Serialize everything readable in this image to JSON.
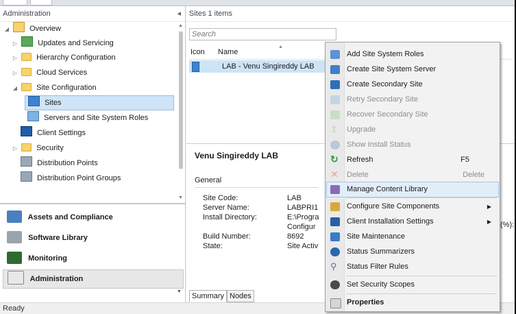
{
  "nav": {
    "header": "Administration",
    "tree": [
      {
        "label": "Overview"
      },
      {
        "label": "Updates and Servicing"
      },
      {
        "label": "Hierarchy Configuration"
      },
      {
        "label": "Cloud Services"
      },
      {
        "label": "Site Configuration"
      },
      {
        "label": "Sites"
      },
      {
        "label": "Servers and Site System Roles"
      },
      {
        "label": "Client Settings"
      },
      {
        "label": "Security"
      },
      {
        "label": "Distribution Points"
      },
      {
        "label": "Distribution Point Groups"
      }
    ],
    "workspaces": [
      {
        "label": "Assets and Compliance"
      },
      {
        "label": "Software Library"
      },
      {
        "label": "Monitoring"
      },
      {
        "label": "Administration"
      }
    ]
  },
  "main": {
    "breadcrumb": "Sites 1 items",
    "search_placeholder": "Search",
    "columns": [
      "Icon",
      "Name"
    ],
    "rows": [
      {
        "name": "LAB - Venu Singireddy LAB"
      }
    ],
    "detail": {
      "title": "Venu Singireddy LAB",
      "section": "General",
      "fields": [
        {
          "key": "Site Code:",
          "value": "LAB"
        },
        {
          "key": "Server Name:",
          "value": "LABPRI1"
        },
        {
          "key": "Install Directory:",
          "value": "E:\\Progra"
        },
        {
          "key": "",
          "value": "Configur"
        },
        {
          "key": "Build Number:",
          "value": "8692"
        },
        {
          "key": "State:",
          "value": "Site Activ"
        }
      ],
      "overflow_text": "(%):"
    },
    "tabs": [
      "Summary",
      "Nodes"
    ]
  },
  "context_menu": {
    "items": [
      {
        "label": "Add Site System Roles",
        "shortcut": "",
        "disabled": false,
        "icon": "add-roles-icon"
      },
      {
        "label": "Create Site System Server",
        "shortcut": "",
        "disabled": false,
        "icon": "server-icon"
      },
      {
        "label": "Create Secondary Site",
        "shortcut": "",
        "disabled": false,
        "icon": "secondary-site-icon"
      },
      {
        "label": "Retry Secondary Site",
        "shortcut": "",
        "disabled": true,
        "icon": "retry-icon"
      },
      {
        "label": "Recover Secondary Site",
        "shortcut": "",
        "disabled": true,
        "icon": "recover-icon"
      },
      {
        "label": "Upgrade",
        "shortcut": "",
        "disabled": true,
        "icon": "upgrade-icon"
      },
      {
        "label": "Show Install Status",
        "shortcut": "",
        "disabled": true,
        "icon": "info-icon"
      },
      {
        "label": "Refresh",
        "shortcut": "F5",
        "disabled": false,
        "icon": "refresh-icon"
      },
      {
        "label": "Delete",
        "shortcut": "Delete",
        "disabled": true,
        "icon": "delete-icon"
      },
      {
        "label": "Manage Content Library",
        "shortcut": "",
        "disabled": false,
        "icon": "content-library-icon",
        "highlighted": true
      },
      {
        "label": "Configure Site Components",
        "shortcut": "",
        "disabled": false,
        "icon": "configure-icon",
        "submenu": true
      },
      {
        "label": "Client Installation Settings",
        "shortcut": "",
        "disabled": false,
        "icon": "client-install-icon",
        "submenu": true
      },
      {
        "label": "Site Maintenance",
        "shortcut": "",
        "disabled": false,
        "icon": "maintenance-icon"
      },
      {
        "label": "Status Summarizers",
        "shortcut": "",
        "disabled": false,
        "icon": "status-summarizer-icon"
      },
      {
        "label": "Status Filter Rules",
        "shortcut": "",
        "disabled": false,
        "icon": "filter-icon"
      },
      {
        "label": "Set Security Scopes",
        "shortcut": "",
        "disabled": false,
        "icon": "security-scope-icon"
      },
      {
        "label": "Properties",
        "shortcut": "",
        "disabled": false,
        "icon": "properties-icon",
        "bold": true
      }
    ]
  },
  "status_bar": "Ready",
  "colors": {
    "selection": "#cfe4f7",
    "menu_bg": "#f2f2f2",
    "accent": "#2b6cb0"
  }
}
